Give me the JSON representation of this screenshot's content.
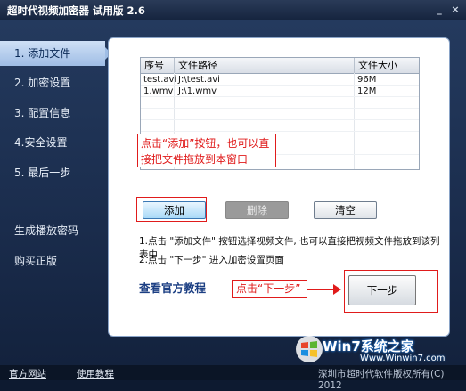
{
  "window": {
    "title": "超时代视频加密器 试用版 2.6",
    "minimize_glyph": "_",
    "close_glyph": "×"
  },
  "sidebar": {
    "items": [
      {
        "label": "1. 添加文件",
        "active": true
      },
      {
        "label": "2. 加密设置",
        "active": false
      },
      {
        "label": "3. 配置信息",
        "active": false
      },
      {
        "label": "4.安全设置",
        "active": false
      },
      {
        "label": "5. 最后一步",
        "active": false
      }
    ],
    "links": [
      {
        "label": "生成播放密码"
      },
      {
        "label": "购买正版"
      }
    ]
  },
  "file_table": {
    "columns": [
      "序号",
      "文件路径",
      "文件大小"
    ],
    "rows": [
      {
        "name": "test.avi",
        "path": "J:\\test.avi",
        "size": "96M"
      },
      {
        "name": "1.wmv",
        "path": "J:\\1.wmv",
        "size": "12M"
      }
    ]
  },
  "callouts": {
    "add_note": "点击“添加”按钮，也可以直接把文件拖放到本窗口",
    "next_note": "点击“下一步”"
  },
  "buttons": {
    "add": "添加",
    "delete": "删除",
    "clear": "清空",
    "next": "下一步"
  },
  "hints": {
    "line1": "1.点击 \"添加文件\" 按钮选择视频文件, 也可以直接把视频文件拖放到该列表中",
    "line2": "2.点击 \"下一步\" 进入加密设置页面"
  },
  "tutorial_link": "查看官方教程",
  "footer": {
    "official_site": "官方网站",
    "tutorial": "使用教程",
    "copyright": "深圳市超时代软件版权所有(C) 2012"
  },
  "watermark": {
    "line1": "Win7系统之家",
    "line2": "Www.Winwin7.com"
  },
  "colors": {
    "accent_red": "#e01b1b",
    "nav_active": "#9fbde5",
    "link_blue": "#1c3f83"
  }
}
